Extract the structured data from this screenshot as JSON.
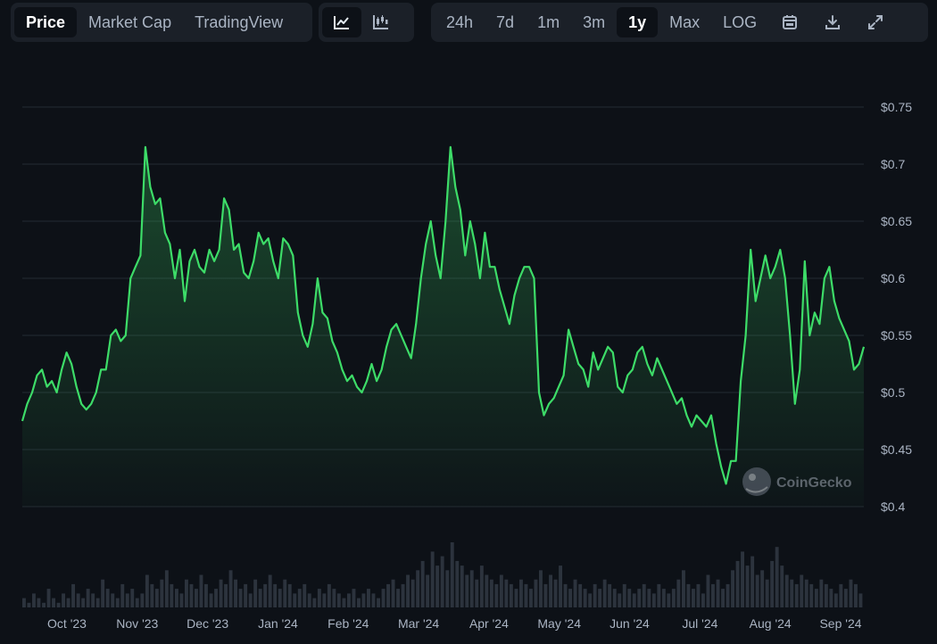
{
  "toolbar": {
    "view_tabs": [
      {
        "label": "Price",
        "active": true
      },
      {
        "label": "Market Cap",
        "active": false
      },
      {
        "label": "TradingView",
        "active": false
      }
    ],
    "chart_type_icons": [
      "line-chart-icon",
      "candlestick-icon"
    ],
    "range_tabs": [
      {
        "label": "24h",
        "active": false
      },
      {
        "label": "7d",
        "active": false
      },
      {
        "label": "1m",
        "active": false
      },
      {
        "label": "3m",
        "active": false
      },
      {
        "label": "1y",
        "active": true
      },
      {
        "label": "Max",
        "active": false
      },
      {
        "label": "LOG",
        "active": false
      }
    ],
    "action_icons": [
      "calendar-icon",
      "download-icon",
      "expand-icon"
    ]
  },
  "watermark": "CoinGecko",
  "colors": {
    "background": "#0d1117",
    "line": "#3ddc68",
    "grid": "#232a33",
    "text": "#aab4c3",
    "volume": "#2c333d"
  },
  "chart_data": {
    "type": "area",
    "x_ticks": [
      "Oct '23",
      "Nov '23",
      "Dec '23",
      "Jan '24",
      "Feb '24",
      "Mar '24",
      "Apr '24",
      "May '24",
      "Jun '24",
      "Jul '24",
      "Aug '24",
      "Sep '24"
    ],
    "y_ticks": [
      "$0.75",
      "$0.7",
      "$0.65",
      "$0.6",
      "$0.55",
      "$0.5",
      "$0.45",
      "$0.4"
    ],
    "ylim": [
      0.4,
      0.75
    ],
    "grid": true,
    "series": [
      {
        "values": [
          0.475,
          0.49,
          0.5,
          0.515,
          0.52,
          0.505,
          0.51,
          0.5,
          0.52,
          0.535,
          0.525,
          0.505,
          0.49,
          0.485,
          0.49,
          0.5,
          0.52,
          0.52,
          0.55,
          0.555,
          0.545,
          0.55,
          0.6,
          0.61,
          0.62,
          0.715,
          0.68,
          0.665,
          0.67,
          0.64,
          0.63,
          0.6,
          0.625,
          0.58,
          0.615,
          0.625,
          0.61,
          0.605,
          0.625,
          0.615,
          0.625,
          0.67,
          0.66,
          0.625,
          0.63,
          0.605,
          0.6,
          0.615,
          0.64,
          0.63,
          0.635,
          0.615,
          0.6,
          0.635,
          0.63,
          0.62,
          0.57,
          0.55,
          0.54,
          0.56,
          0.6,
          0.57,
          0.565,
          0.545,
          0.535,
          0.52,
          0.51,
          0.515,
          0.505,
          0.5,
          0.51,
          0.525,
          0.51,
          0.52,
          0.54,
          0.555,
          0.56,
          0.55,
          0.54,
          0.53,
          0.56,
          0.6,
          0.63,
          0.65,
          0.62,
          0.6,
          0.65,
          0.715,
          0.68,
          0.66,
          0.62,
          0.65,
          0.63,
          0.6,
          0.64,
          0.61,
          0.61,
          0.59,
          0.575,
          0.56,
          0.585,
          0.6,
          0.61,
          0.61,
          0.6,
          0.5,
          0.48,
          0.49,
          0.495,
          0.505,
          0.515,
          0.555,
          0.54,
          0.525,
          0.52,
          0.505,
          0.535,
          0.52,
          0.53,
          0.54,
          0.535,
          0.505,
          0.5,
          0.515,
          0.52,
          0.535,
          0.54,
          0.525,
          0.515,
          0.53,
          0.52,
          0.51,
          0.5,
          0.49,
          0.495,
          0.48,
          0.47,
          0.48,
          0.475,
          0.47,
          0.48,
          0.455,
          0.435,
          0.42,
          0.44,
          0.44,
          0.51,
          0.55,
          0.625,
          0.58,
          0.6,
          0.62,
          0.6,
          0.61,
          0.625,
          0.6,
          0.55,
          0.49,
          0.52,
          0.615,
          0.55,
          0.57,
          0.56,
          0.6,
          0.61,
          0.58,
          0.565,
          0.555,
          0.545,
          0.52,
          0.525,
          0.54
        ]
      }
    ],
    "volume": [
      2,
      1,
      3,
      2,
      1,
      4,
      2,
      1,
      3,
      2,
      5,
      3,
      2,
      4,
      3,
      2,
      6,
      4,
      3,
      2,
      5,
      3,
      4,
      2,
      3,
      7,
      5,
      4,
      6,
      8,
      5,
      4,
      3,
      6,
      5,
      4,
      7,
      5,
      3,
      4,
      6,
      5,
      8,
      6,
      4,
      5,
      3,
      6,
      4,
      5,
      7,
      5,
      4,
      6,
      5,
      3,
      4,
      5,
      3,
      2,
      4,
      3,
      5,
      4,
      3,
      2,
      3,
      4,
      2,
      3,
      4,
      3,
      2,
      4,
      5,
      6,
      4,
      5,
      7,
      6,
      8,
      10,
      7,
      12,
      9,
      11,
      8,
      14,
      10,
      9,
      7,
      8,
      6,
      9,
      7,
      6,
      5,
      7,
      6,
      5,
      4,
      6,
      5,
      4,
      6,
      8,
      5,
      7,
      6,
      9,
      5,
      4,
      6,
      5,
      4,
      3,
      5,
      4,
      6,
      5,
      4,
      3,
      5,
      4,
      3,
      4,
      5,
      4,
      3,
      5,
      4,
      3,
      4,
      6,
      8,
      5,
      4,
      5,
      3,
      7,
      5,
      6,
      4,
      5,
      8,
      10,
      12,
      9,
      11,
      7,
      8,
      6,
      10,
      13,
      9,
      7,
      6,
      5,
      7,
      6,
      5,
      4,
      6,
      5,
      4,
      3,
      5,
      4,
      6,
      5,
      3
    ]
  }
}
